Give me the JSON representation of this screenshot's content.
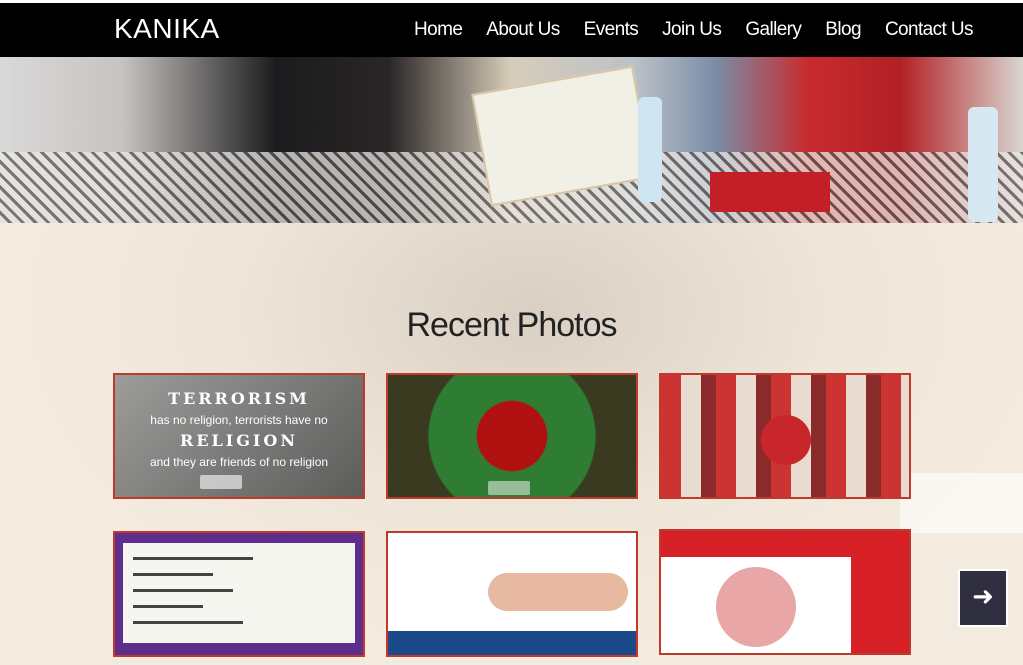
{
  "brand": "KANIKA",
  "nav": [
    {
      "label": "Home"
    },
    {
      "label": "About Us"
    },
    {
      "label": "Events"
    },
    {
      "label": "Join Us"
    },
    {
      "label": "Gallery"
    },
    {
      "label": "Blog"
    },
    {
      "label": "Contact Us"
    }
  ],
  "section_title": "Recent Photos",
  "photo1": {
    "line1": "TERRORISM",
    "line2": "has no religion, terrorists have no",
    "line3": "RELIGION",
    "line4": "and they are friends of no religion"
  },
  "next_button_icon": "arrow-right-icon",
  "colors": {
    "nav_bg": "#000000",
    "accent": "#c0392b",
    "next_bg": "#2f2f3f"
  }
}
